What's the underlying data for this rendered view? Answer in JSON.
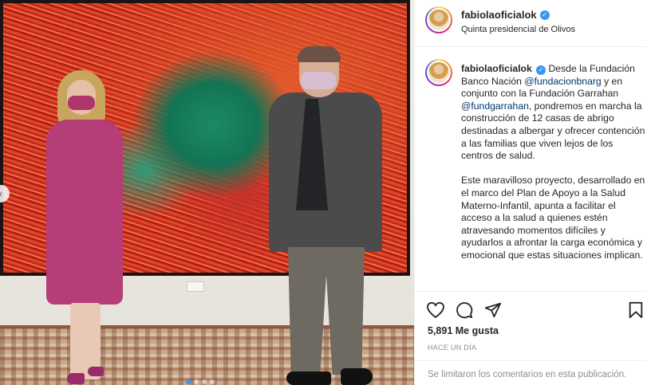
{
  "post": {
    "username": "fabiolaoficialok",
    "location": "Quinta presidencial de Olivos",
    "verified_icon": "verified-badge-icon",
    "caption": {
      "username": "fabiolaoficialok",
      "p1_a": "Desde la Fundación Banco Nación",
      "mention1": "@fundacionbnarg",
      "p1_b": "y en conjunto con la Fundación Garrahan",
      "mention2": "@fundgarrahan",
      "p1_c": ", pondremos en marcha la construcción de 12 casas de abrigo destinadas a albergar y ofrecer contención a las familias que viven lejos de los centros de salud.",
      "p2": "Este maravilloso proyecto, desarrollado en el marco del Plan de Apoyo a la Salud Materno-Infantil, apunta a facilitar el acceso a la salud a quienes estén atravesando momentos difíciles y ayudarlos a afrontar la carga económica y emocional que estas situaciones implican."
    },
    "likes": "5,891 Me gusta",
    "time": "HACE UN DÍA",
    "comments_disabled": "Se limitaron los comentarios en esta publicación.",
    "carousel_prev_icon": "‹",
    "carousel_dots": 4,
    "carousel_active_index": 0
  },
  "icons": {
    "like": "heart-icon",
    "comment": "comment-bubble-icon",
    "share": "paper-plane-icon",
    "save": "bookmark-icon"
  },
  "colors": {
    "link": "#00376b",
    "verified": "#3897f0",
    "muted": "#8e8e8e",
    "text": "#262626",
    "dress": "#b53d78",
    "painting_red": "#c7271f",
    "painting_green": "#137454"
  }
}
